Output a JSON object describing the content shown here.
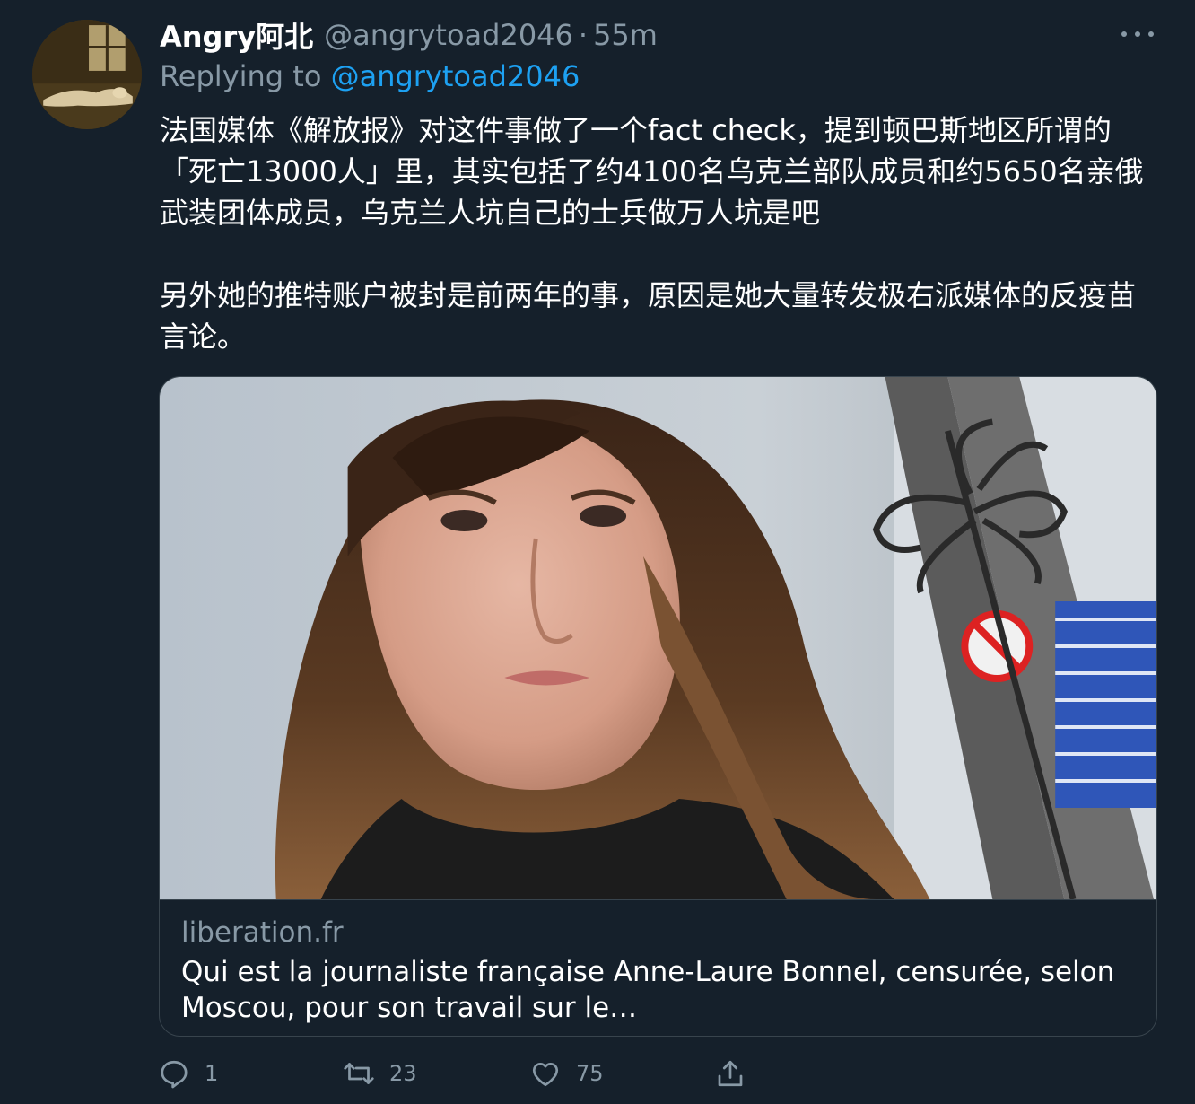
{
  "tweet": {
    "author": {
      "display_name": "Angry阿北",
      "handle": "@angrytoad2046",
      "separator": "·",
      "time": "55m",
      "avatar_icon": "avatar-image"
    },
    "reply": {
      "prefix": "Replying to",
      "mention": "@angrytoad2046"
    },
    "paragraphs": [
      "法国媒体《解放报》对这件事做了一个fact check，提到顿巴斯地区所谓的「死亡13000人」里，其实包括了约4100名乌克兰部队成员和约5650名亲俄武装团体成员，乌克兰人坑自己的士兵做万人坑是吧",
      "另外她的推特账户被封是前两年的事，原因是她大量转发极右派媒体的反疫苗言论。"
    ],
    "card": {
      "domain": "liberation.fr",
      "title": "Qui est la journaliste française Anne-Laure Bonnel, censurée, selon Moscou, pour son travail sur le…"
    },
    "actions": {
      "reply": {
        "icon": "reply-icon",
        "count": "1"
      },
      "retweet": {
        "icon": "retweet-icon",
        "count": "23"
      },
      "like": {
        "icon": "heart-icon",
        "count": "75"
      },
      "share": {
        "icon": "share-icon"
      }
    }
  },
  "colors": {
    "background": "#15202b",
    "text_primary": "#ffffff",
    "text_secondary": "#8899a6",
    "link": "#1da1f2",
    "border": "#38444d"
  }
}
